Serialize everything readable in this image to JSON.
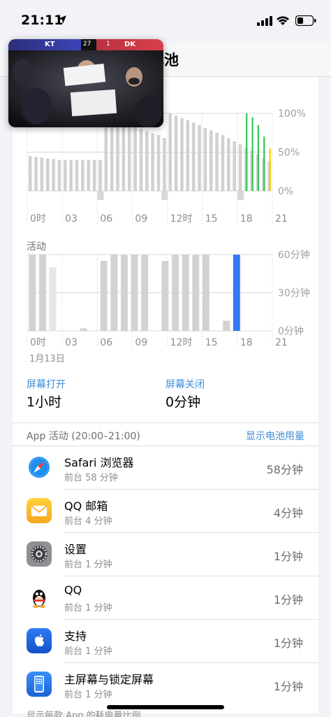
{
  "status_bar": {
    "time": "21:11"
  },
  "header": {
    "title": "电池"
  },
  "pip_overlay": {
    "team_left": "KT",
    "team_right": "DK",
    "score_left": "27",
    "score_right": "1"
  },
  "battery_chart": {
    "y_ticks": [
      "100%",
      "50%",
      "0%"
    ],
    "x_ticks": [
      "0时",
      "03",
      "06",
      "09",
      "12时",
      "15",
      "18",
      "21"
    ]
  },
  "activity_section": {
    "label": "活动",
    "date": "1月13日",
    "y_ticks": [
      "60分钟",
      "30分钟",
      "0分钟"
    ],
    "x_ticks": [
      "0时",
      "03",
      "06",
      "09",
      "12时",
      "15",
      "18",
      "21"
    ]
  },
  "chart_data": [
    {
      "type": "bar",
      "title": "",
      "y_unit": "%",
      "ylim": [
        0,
        100
      ],
      "x": [
        "00:00",
        "00:30",
        "01:00",
        "01:30",
        "02:00",
        "02:30",
        "03:00",
        "03:30",
        "04:00",
        "04:30",
        "05:00",
        "05:30",
        "06:00",
        "06:30",
        "07:00",
        "07:30",
        "08:00",
        "08:30",
        "09:00",
        "09:30",
        "10:00",
        "10:30",
        "11:00",
        "11:30",
        "12:00",
        "12:30",
        "13:00",
        "13:30",
        "14:00",
        "14:30",
        "15:00",
        "15:30",
        "16:00",
        "16:30",
        "17:00",
        "17:30",
        "18:00",
        "18:30",
        "19:00",
        "19:30",
        "20:00",
        "20:30"
      ],
      "series": [
        {
          "values": [
            45,
            44,
            43,
            42,
            41,
            40,
            40,
            40,
            40,
            40,
            40,
            40,
            40,
            100,
            95,
            92,
            90,
            87,
            84,
            80,
            77,
            74,
            72,
            68,
            100,
            97,
            94,
            91,
            88,
            85,
            81,
            78,
            75,
            72,
            68,
            64,
            60,
            56,
            52,
            47,
            42,
            38
          ],
          "kind": "battery_level"
        },
        {
          "values": [
            0,
            0,
            0,
            0,
            0,
            0,
            0,
            0,
            0,
            0,
            0,
            0,
            0,
            0,
            0,
            0,
            0,
            0,
            0,
            0,
            0,
            0,
            0,
            0,
            0,
            0,
            0,
            0,
            0,
            0,
            0,
            0,
            0,
            0,
            0,
            0,
            0,
            100,
            95,
            85,
            70,
            55
          ],
          "kind": "battery_level_today"
        }
      ],
      "highlight_colors": [
        "#34c759",
        "#ffcc00"
      ],
      "grid": true
    },
    {
      "type": "bar",
      "title": "",
      "ylim": [
        0,
        60
      ],
      "y_unit": "分钟",
      "x": [
        "00",
        "01",
        "02",
        "03",
        "04",
        "05",
        "06",
        "07",
        "08",
        "09",
        "10",
        "11",
        "12",
        "13",
        "14",
        "15",
        "16",
        "17",
        "18",
        "19",
        "20"
      ],
      "series": [
        {
          "name": "screen_on",
          "values": [
            60,
            60,
            50,
            0,
            0,
            2,
            0,
            55,
            60,
            60,
            60,
            60,
            0,
            55,
            60,
            60,
            60,
            60,
            0,
            8,
            60
          ],
          "colors": [
            "#d2d2d2",
            "#d2d2d2",
            "#e6e6e6",
            "#d2d2d2",
            "#d2d2d2",
            "#d2d2d2",
            "#d2d2d2",
            "#d2d2d2",
            "#d2d2d2",
            "#d2d2d2",
            "#d2d2d2",
            "#d2d2d2",
            "#d2d2d2",
            "#d2d2d2",
            "#d2d2d2",
            "#d2d2d2",
            "#d2d2d2",
            "#d2d2d2",
            "#d2d2d2",
            "#d2d2d2",
            "#3478f6"
          ]
        }
      ],
      "grid": true
    }
  ],
  "summary": {
    "screen_on_label": "屏幕打开",
    "screen_on_value": "1小时",
    "screen_off_label": "屏幕关闭",
    "screen_off_value": "0分钟"
  },
  "app_activity": {
    "header": "App 活动 (20:00–21:00)",
    "toggle": "显示电池用量",
    "apps": [
      {
        "name": "Safari 浏览器",
        "detail": "前台 58 分钟",
        "time": "58分钟",
        "icon": "safari-icon"
      },
      {
        "name": "QQ 邮箱",
        "detail": "前台 4 分钟",
        "time": "4分钟",
        "icon": "mail-icon"
      },
      {
        "name": "设置",
        "detail": "前台 1 分钟",
        "time": "1分钟",
        "icon": "settings-gear-icon"
      },
      {
        "name": "QQ",
        "detail": "前台 1 分钟",
        "time": "1分钟",
        "icon": "qq-penguin-icon"
      },
      {
        "name": "支持",
        "detail": "前台 1 分钟",
        "time": "1分钟",
        "icon": "apple-support-icon"
      },
      {
        "name": "主屏幕与锁定屏幕",
        "detail": "前台 1 分钟",
        "time": "1分钟",
        "icon": "home-screen-icon"
      }
    ]
  },
  "footer": {
    "text": "显示每款 App 的耗电量比例"
  }
}
